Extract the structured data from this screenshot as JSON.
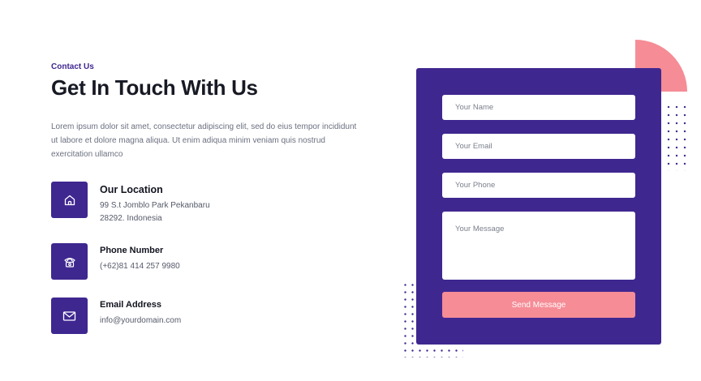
{
  "header": {
    "eyebrow": "Contact Us",
    "title": "Get In Touch With Us",
    "intro": "Lorem ipsum dolor sit amet, consectetur adipiscing elit, sed do eius tempor incididunt ut labore et dolore magna aliqua. Ut enim adiqua minim veniam quis nostrud exercitation ullamco"
  },
  "contact": {
    "location": {
      "icon": "home-icon",
      "title": "Our Location",
      "line1": "99 S.t Jomblo Park Pekanbaru",
      "line2": "28292. Indonesia"
    },
    "phone": {
      "icon": "phone-icon",
      "title": "Phone Number",
      "line1": "(+62)81 414 257 9980"
    },
    "email": {
      "icon": "mail-icon",
      "title": "Email Address",
      "line1": "info@yourdomain.com"
    }
  },
  "form": {
    "name_placeholder": "Your Name",
    "email_placeholder": "Your Email",
    "phone_placeholder": "Your Phone",
    "message_placeholder": "Your Message",
    "submit_label": "Send Message"
  },
  "colors": {
    "primary": "#3f2790",
    "accent": "#f58c96",
    "heading": "#171924",
    "body_text": "#6b7080"
  }
}
